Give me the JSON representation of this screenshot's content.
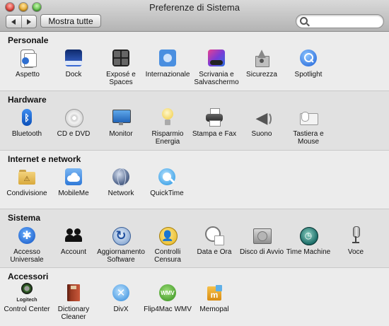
{
  "window": {
    "title": "Preferenze di Sistema"
  },
  "toolbar": {
    "show_all": "Mostra tutte",
    "search_placeholder": ""
  },
  "sections": [
    {
      "title": "Personale",
      "items": [
        {
          "label": "Aspetto",
          "icon": "appearance-icon"
        },
        {
          "label": "Dock",
          "icon": "dock-icon"
        },
        {
          "label": "Exposé e Spaces",
          "icon": "expose-icon"
        },
        {
          "label": "Internazionale",
          "icon": "flag-icon"
        },
        {
          "label": "Scrivania e Salvaschermo",
          "icon": "desktop-icon"
        },
        {
          "label": "Sicurezza",
          "icon": "house-lock-icon"
        },
        {
          "label": "Spotlight",
          "icon": "magnifier-icon"
        }
      ]
    },
    {
      "title": "Hardware",
      "items": [
        {
          "label": "Bluetooth",
          "icon": "bluetooth-icon"
        },
        {
          "label": "CD e DVD",
          "icon": "disc-icon"
        },
        {
          "label": "Monitor",
          "icon": "display-icon"
        },
        {
          "label": "Risparmio Energia",
          "icon": "lightbulb-icon"
        },
        {
          "label": "Stampa e Fax",
          "icon": "printer-icon"
        },
        {
          "label": "Suono",
          "icon": "speaker-icon"
        },
        {
          "label": "Tastiera e Mouse",
          "icon": "keyboard-mouse-icon"
        }
      ]
    },
    {
      "title": "Internet e network",
      "items": [
        {
          "label": "Condivisione",
          "icon": "shared-folder-icon"
        },
        {
          "label": "MobileMe",
          "icon": "cloud-icon"
        },
        {
          "label": "Network",
          "icon": "globe-icon"
        },
        {
          "label": "QuickTime",
          "icon": "quicktime-icon"
        }
      ]
    },
    {
      "title": "Sistema",
      "items": [
        {
          "label": "Accesso Universale",
          "icon": "accessibility-icon"
        },
        {
          "label": "Account",
          "icon": "users-icon"
        },
        {
          "label": "Aggiornamento Software",
          "icon": "software-update-icon"
        },
        {
          "label": "Controlli Censura",
          "icon": "parental-controls-icon"
        },
        {
          "label": "Data e Ora",
          "icon": "clock-calendar-icon"
        },
        {
          "label": "Disco di Avvio",
          "icon": "hard-disk-icon"
        },
        {
          "label": "Time Machine",
          "icon": "time-machine-icon"
        },
        {
          "label": "Voce",
          "icon": "microphone-icon"
        }
      ]
    },
    {
      "title": "Accessori",
      "items": [
        {
          "label": "Control Center",
          "icon": "logitech-icon",
          "badge": "Logitech"
        },
        {
          "label": "Dictionary Cleaner",
          "icon": "book-icon"
        },
        {
          "label": "DivX",
          "icon": "divx-icon"
        },
        {
          "label": "Flip4Mac WMV",
          "icon": "wmv-icon",
          "badge": "WMV"
        },
        {
          "label": "Memopal",
          "icon": "memopal-icon",
          "badge": "m"
        }
      ]
    }
  ]
}
